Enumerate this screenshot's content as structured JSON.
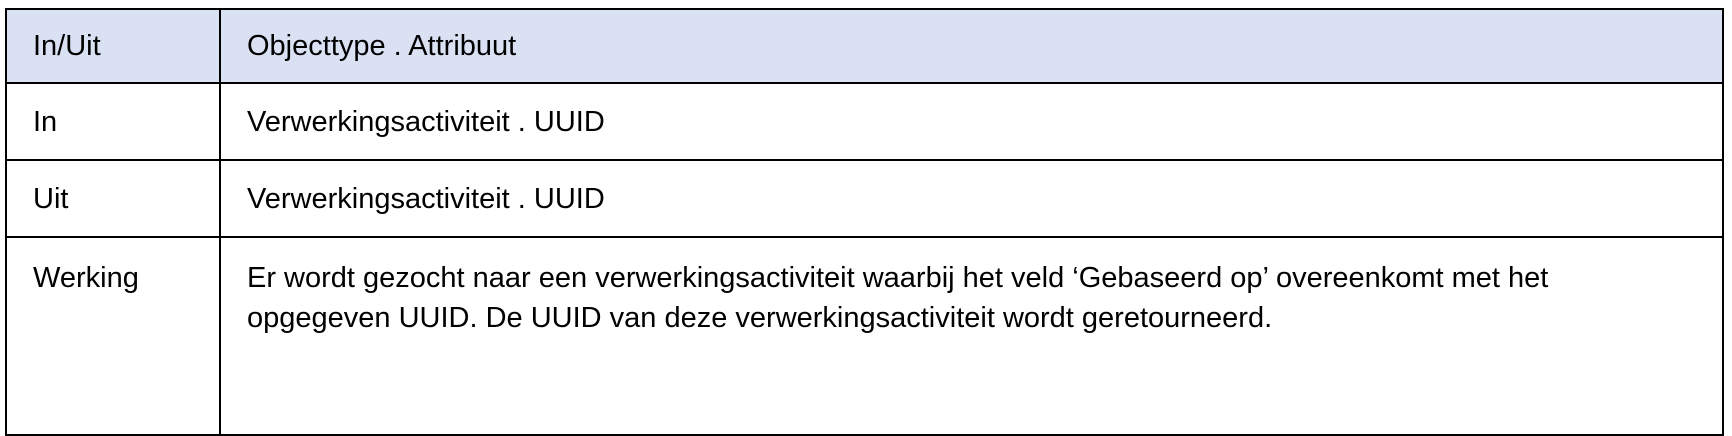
{
  "table": {
    "headers": [
      "In/Uit",
      "Objecttype . Attribuut"
    ],
    "rows": [
      {
        "label": "In",
        "value": "Verwerkingsactiviteit . UUID"
      },
      {
        "label": "Uit",
        "value": "Verwerkingsactiviteit . UUID"
      },
      {
        "label": "Werking",
        "value": "Er wordt gezocht naar een verwerkingsactiviteit waarbij het veld ‘Gebaseerd op’ overeenkomt met het opgegeven UUID. De UUID van deze verwerkingsactiviteit wordt geretourneerd."
      }
    ]
  }
}
